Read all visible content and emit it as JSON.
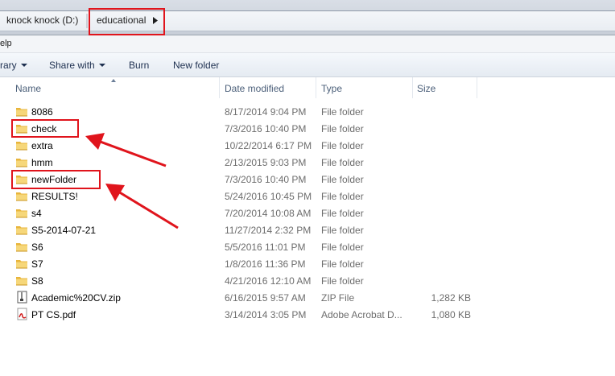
{
  "address": {
    "drive": "knock knock (D:)",
    "folder": "educational"
  },
  "menubar": {
    "fragment": "elp"
  },
  "toolbar": {
    "library": "rary",
    "share_with": "Share with",
    "burn": "Burn",
    "new_folder": "New folder"
  },
  "columns": {
    "name": "Name",
    "date": "Date modified",
    "type": "Type",
    "size": "Size"
  },
  "files": [
    {
      "name": "8086",
      "date": "8/17/2014 9:04 PM",
      "type": "File folder",
      "size": "",
      "icon": "folder-icon"
    },
    {
      "name": "check",
      "date": "7/3/2016 10:40 PM",
      "type": "File folder",
      "size": "",
      "icon": "folder-icon"
    },
    {
      "name": "extra",
      "date": "10/22/2014 6:17 PM",
      "type": "File folder",
      "size": "",
      "icon": "folder-icon"
    },
    {
      "name": "hmm",
      "date": "2/13/2015 9:03 PM",
      "type": "File folder",
      "size": "",
      "icon": "folder-icon"
    },
    {
      "name": "newFolder",
      "date": "7/3/2016 10:40 PM",
      "type": "File folder",
      "size": "",
      "icon": "folder-icon"
    },
    {
      "name": "RESULTS!",
      "date": "5/24/2016 10:45 PM",
      "type": "File folder",
      "size": "",
      "icon": "folder-icon"
    },
    {
      "name": "s4",
      "date": "7/20/2014 10:08 AM",
      "type": "File folder",
      "size": "",
      "icon": "folder-icon"
    },
    {
      "name": "S5-2014-07-21",
      "date": "11/27/2014 2:32 PM",
      "type": "File folder",
      "size": "",
      "icon": "folder-icon"
    },
    {
      "name": "S6",
      "date": "5/5/2016 11:01 PM",
      "type": "File folder",
      "size": "",
      "icon": "folder-icon"
    },
    {
      "name": "S7",
      "date": "1/8/2016 11:36 PM",
      "type": "File folder",
      "size": "",
      "icon": "folder-icon"
    },
    {
      "name": "S8",
      "date": "4/21/2016 12:10 AM",
      "type": "File folder",
      "size": "",
      "icon": "folder-icon"
    },
    {
      "name": "Academic%20CV.zip",
      "date": "6/16/2015 9:57 AM",
      "type": "ZIP File",
      "size": "1,282 KB",
      "icon": "zip-file-icon"
    },
    {
      "name": "PT CS.pdf",
      "date": "3/14/2014 3:05 PM",
      "type": "Adobe Acrobat D...",
      "size": "1,080 KB",
      "icon": "pdf-file-icon"
    }
  ],
  "colors": {
    "annotation_red": "#e0141c",
    "folder_yellow": "#f2c94c"
  }
}
